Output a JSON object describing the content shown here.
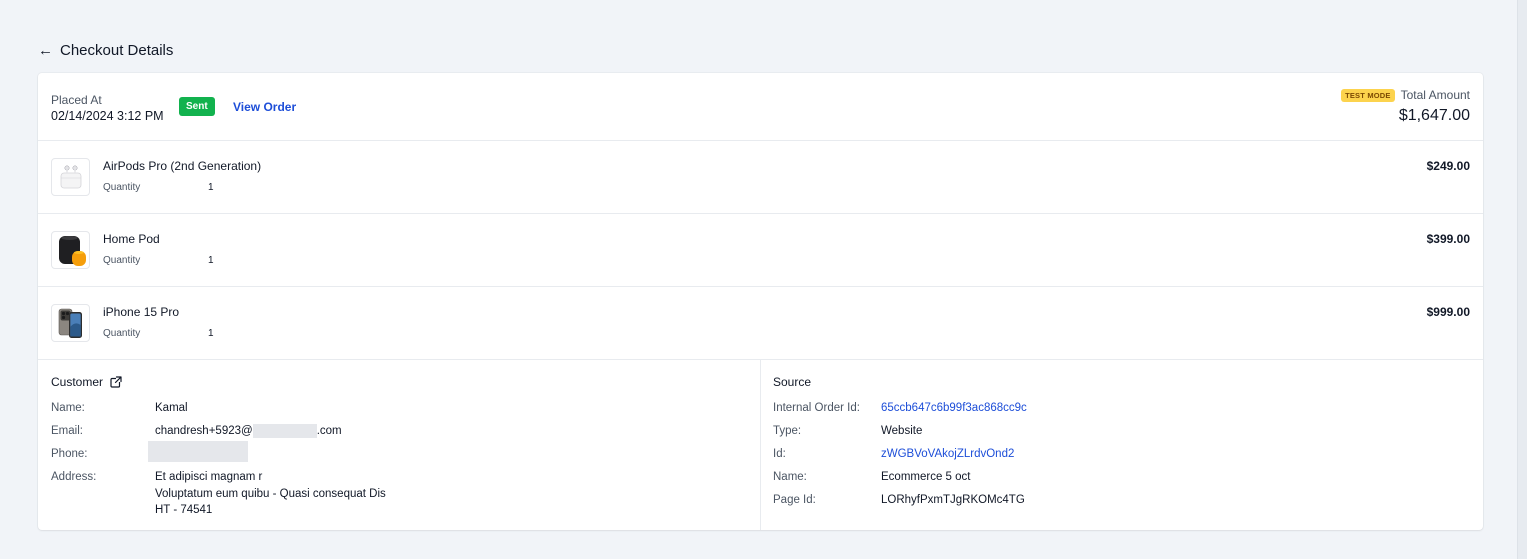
{
  "header": {
    "back_icon": "arrow-left-icon",
    "title": "Checkout Details"
  },
  "order": {
    "placed_label": "Placed At",
    "placed_value": "02/14/2024 3:12 PM",
    "status": "Sent",
    "view_order_label": "View Order",
    "test_mode_label": "TEST MODE",
    "total_label": "Total Amount",
    "total_value": "$1,647.00"
  },
  "items": [
    {
      "name": "AirPods Pro (2nd Generation)",
      "quantity_label": "Quantity",
      "quantity": "1",
      "price": "$249.00",
      "icon": "airpods-icon"
    },
    {
      "name": "Home Pod",
      "quantity_label": "Quantity",
      "quantity": "1",
      "price": "$399.00",
      "icon": "homepod-icon"
    },
    {
      "name": "iPhone 15 Pro",
      "quantity_label": "Quantity",
      "quantity": "1",
      "price": "$999.00",
      "icon": "iphone-icon"
    }
  ],
  "customer": {
    "title": "Customer",
    "name_label": "Name:",
    "name": "Kamal",
    "email_label": "Email:",
    "email_prefix": "chandresh+5923@",
    "email_suffix": ".com",
    "phone_label": "Phone:",
    "address_label": "Address:",
    "address_line1": "Et adipisci magnam r",
    "address_line2": "Voluptatum eum quibu - Quasi consequat Dis",
    "address_line3": "HT - 74541"
  },
  "source": {
    "title": "Source",
    "internal_order_id_label": "Internal Order Id:",
    "internal_order_id": "65ccb647c6b99f3ac868cc9c",
    "type_label": "Type:",
    "type": "Website",
    "id_label": "Id:",
    "id": "zWGBVoVAkojZLrdvOnd2",
    "name_label": "Name:",
    "name": "Ecommerce 5 oct",
    "page_id_label": "Page Id:",
    "page_id": "LORhyfPxmTJgRKOMc4TG"
  },
  "colors": {
    "accent": "#1d4ed8",
    "status_green": "#12b24e",
    "test_mode_bg": "#fcd34d"
  }
}
